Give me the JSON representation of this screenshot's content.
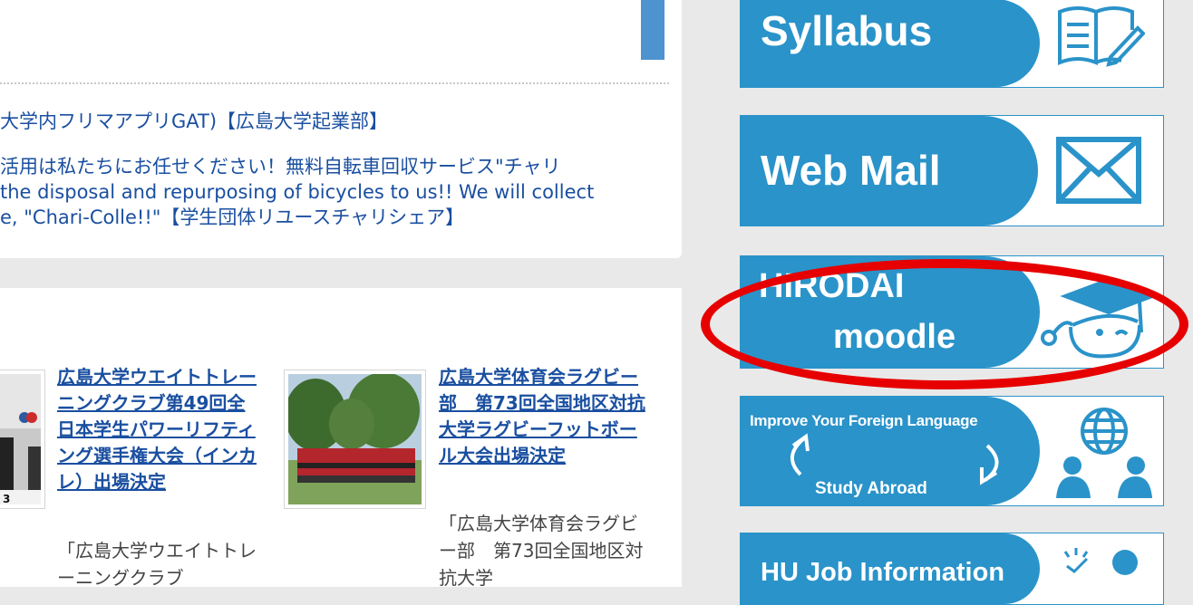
{
  "news": [
    {
      "text": "大学内フリマアプリGAT)【広島大学起業部】"
    },
    {
      "line1": "活用は私たちにお任せください！無料自転車回収サービス\"チャリ",
      "line2": "the disposal and repurposing of bicycles to us!! We will collect",
      "line3": "e, \"Chari-Colle!!\"【学生団体リユースチャリシェア】"
    }
  ],
  "articles": [
    {
      "title": "広島大学ウエイトトレーニングクラブ第49回全日本学生パワーリフティング選手権大会（インカレ）出場決定",
      "excerpt": "「広島大学ウエイトトレーニングクラブ"
    },
    {
      "title": "広島大学体育会ラグビー部　第73回全国地区対抗大学ラグビーフットボール大会出場決定",
      "excerpt": "「広島大学体育会ラグビー部　第73回全国地区対抗大学"
    }
  ],
  "sidebar": {
    "syllabus": {
      "label": "Syllabus",
      "icon": "book-pencil-icon"
    },
    "webmail": {
      "label": "Web Mail",
      "icon": "envelope-icon"
    },
    "moodle": {
      "label1": "HIRODAI",
      "label2": "moodle",
      "icon": "graduation-cap-icon"
    },
    "foreign": {
      "label1": "Improve Your Foreign Language",
      "label2": "Study Abroad",
      "icon": "globe-people-icon"
    },
    "job": {
      "label": "HU Job Information",
      "icon": "person-icon"
    }
  },
  "colors": {
    "accent": "#2a93c9",
    "link": "#1a4fa0",
    "highlight": "#e60000",
    "tab": "#4d93cf"
  }
}
